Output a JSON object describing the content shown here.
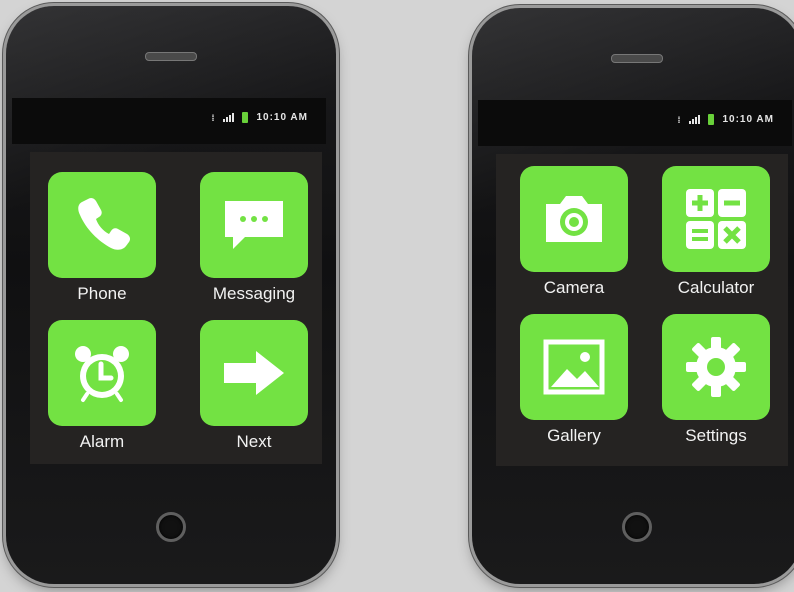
{
  "colors": {
    "tile": "#73e243",
    "screen": "#252322",
    "battery": "#69d13a"
  },
  "phones": [
    {
      "status": {
        "time": "10:10 AM",
        "icons": [
          "sim-icon",
          "signal-icon",
          "battery-icon"
        ]
      },
      "apps": [
        {
          "label": "Phone",
          "icon": "phone-icon"
        },
        {
          "label": "Messaging",
          "icon": "message-bubble-icon"
        },
        {
          "label": "Alarm",
          "icon": "alarm-clock-icon"
        },
        {
          "label": "Next",
          "icon": "arrow-right-icon"
        }
      ]
    },
    {
      "status": {
        "time": "10:10 AM",
        "icons": [
          "sim-icon",
          "signal-icon",
          "battery-icon"
        ]
      },
      "apps": [
        {
          "label": "Camera",
          "icon": "camera-icon"
        },
        {
          "label": "Calculator",
          "icon": "calculator-icon"
        },
        {
          "label": "Gallery",
          "icon": "gallery-image-icon"
        },
        {
          "label": "Settings",
          "icon": "gear-icon"
        }
      ]
    }
  ]
}
